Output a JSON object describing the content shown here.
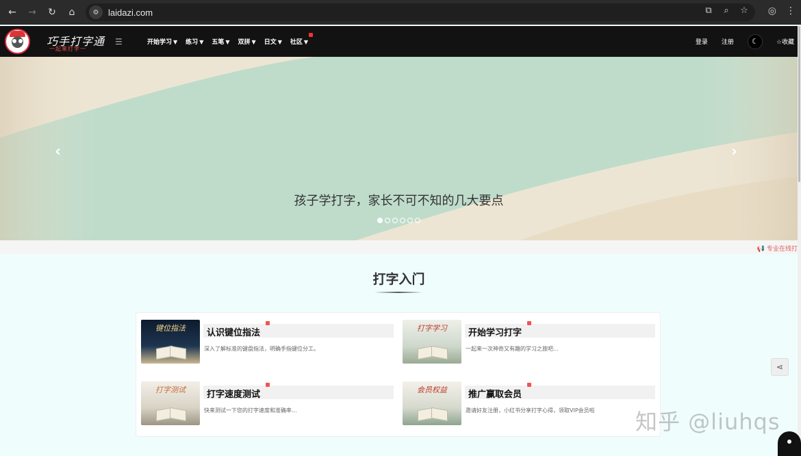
{
  "browser": {
    "url": "laidazi.com",
    "back_icon": "arrow-left-icon",
    "forward_icon": "arrow-right-icon",
    "reload_icon": "reload-icon",
    "home_icon": "home-icon"
  },
  "header": {
    "brand_title": "巧手打字通",
    "brand_subtitle": "一起来打字一",
    "menu": [
      {
        "label": "开始学习",
        "hot": false
      },
      {
        "label": "练习",
        "hot": false
      },
      {
        "label": "五笔",
        "hot": false
      },
      {
        "label": "双拼",
        "hot": false
      },
      {
        "label": "日文",
        "hot": false
      },
      {
        "label": "社区",
        "hot": true
      }
    ],
    "login": "登录",
    "register": "注册",
    "favorite": "☆收藏"
  },
  "banner": {
    "caption": "孩子学打字，家长不可不知的几大要点",
    "slide_count": 6,
    "active_slide": 1
  },
  "notice": "专业在线打",
  "section": {
    "title": "打字入门",
    "cards": [
      {
        "thumb_label": "键位指法",
        "title": "认识键位指法",
        "desc": "深入了解标准的键盘指法，明确手指键位分工。"
      },
      {
        "thumb_label": "打字学习",
        "title": "开始学习打字",
        "desc": "一起来一次神奇又有趣的学习之旅吧..."
      },
      {
        "thumb_label": "打字测试",
        "title": "打字速度测试",
        "desc": "快来测试一下您的打字速度和准确率..."
      },
      {
        "thumb_label": "会员权益",
        "title": "推广赢取会员",
        "desc": "邀请好友注册，小红书分享打字心得，领取VIP会员啦"
      }
    ]
  },
  "watermark": "知乎 @liuhqs",
  "colors": {
    "header_bg": "#121212",
    "banner_green": "#bfdccb",
    "banner_cream": "#ede5d3",
    "hot_red": "#e33"
  }
}
